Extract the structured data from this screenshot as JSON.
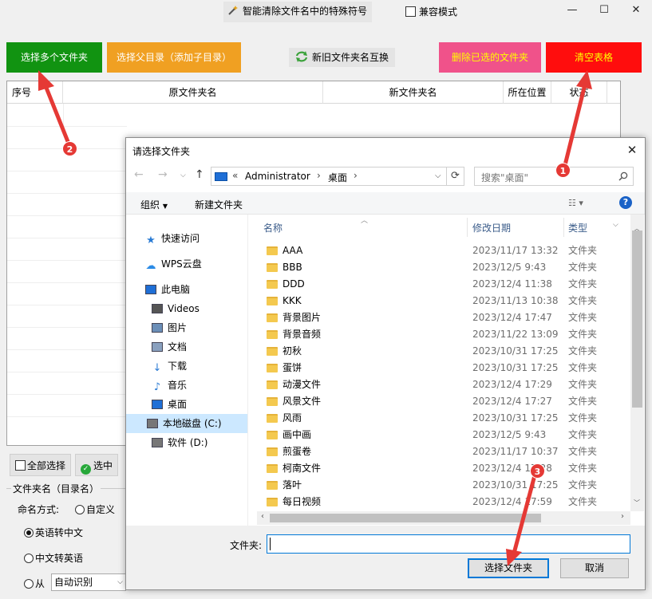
{
  "window": {
    "title": "智能清除文件名中的特殊符号",
    "compat_mode": "兼容模式",
    "min": "—",
    "max": "☐",
    "close": "✕"
  },
  "toolbar": {
    "select_multi": "选择多个文件夹",
    "select_parent": "选择父目录（添加子目录）",
    "swap_names": "新旧文件夹名互换",
    "delete_selected": "删除已选的文件夹",
    "clear_table": "清空表格"
  },
  "table": {
    "columns": [
      "序号",
      "原文件夹名",
      "新文件夹名",
      "所在位置",
      "状态"
    ]
  },
  "bottom": {
    "select_all": "全部选择",
    "select": "选中",
    "section": "文件夹名（目录名）",
    "naming_mode": "命名方式:",
    "custom": "自定义",
    "en_to_cn": "英语转中文",
    "cn_to_en": "中文转英语",
    "from": "从",
    "auto_detect": "自动识别"
  },
  "dialog": {
    "title": "请选择文件夹",
    "path_root": "Administrator",
    "path_current": "桌面",
    "search_placeholder": "搜索\"桌面\"",
    "organize": "组织",
    "new_folder": "新建文件夹",
    "nav": [
      {
        "label": "快速访问",
        "icon": "star-icon"
      },
      {
        "label": "WPS云盘",
        "icon": "cloud-icon"
      },
      {
        "label": "此电脑",
        "icon": "computer-icon"
      },
      {
        "label": "Videos",
        "icon": "video-icon"
      },
      {
        "label": "图片",
        "icon": "picture-icon"
      },
      {
        "label": "文档",
        "icon": "document-icon"
      },
      {
        "label": "下载",
        "icon": "download-icon"
      },
      {
        "label": "音乐",
        "icon": "music-icon"
      },
      {
        "label": "桌面",
        "icon": "desktop-icon"
      },
      {
        "label": "本地磁盘 (C:)",
        "icon": "drive-icon"
      },
      {
        "label": "软件 (D:)",
        "icon": "drive-icon"
      }
    ],
    "columns": {
      "name": "名称",
      "date": "修改日期",
      "type": "类型"
    },
    "files": [
      {
        "name": "AAA",
        "date": "2023/11/17 13:32",
        "type": "文件夹"
      },
      {
        "name": "BBB",
        "date": "2023/12/5 9:43",
        "type": "文件夹"
      },
      {
        "name": "DDD",
        "date": "2023/12/4 11:38",
        "type": "文件夹"
      },
      {
        "name": "KKK",
        "date": "2023/11/13 10:38",
        "type": "文件夹"
      },
      {
        "name": "背景图片",
        "date": "2023/12/4 17:47",
        "type": "文件夹"
      },
      {
        "name": "背景音频",
        "date": "2023/11/22 13:09",
        "type": "文件夹"
      },
      {
        "name": "初秋",
        "date": "2023/10/31 17:25",
        "type": "文件夹"
      },
      {
        "name": "蛋饼",
        "date": "2023/10/31 17:25",
        "type": "文件夹"
      },
      {
        "name": "动漫文件",
        "date": "2023/12/4 17:29",
        "type": "文件夹"
      },
      {
        "name": "风景文件",
        "date": "2023/12/4 17:27",
        "type": "文件夹"
      },
      {
        "name": "风雨",
        "date": "2023/10/31 17:25",
        "type": "文件夹"
      },
      {
        "name": "画中画",
        "date": "2023/12/5 9:43",
        "type": "文件夹"
      },
      {
        "name": "煎蛋卷",
        "date": "2023/11/17 10:37",
        "type": "文件夹"
      },
      {
        "name": "柯南文件",
        "date": "2023/12/4 17:28",
        "type": "文件夹"
      },
      {
        "name": "落叶",
        "date": "2023/10/31 17:25",
        "type": "文件夹"
      },
      {
        "name": "每日视频",
        "date": "2023/12/4 17:59",
        "type": "文件夹"
      }
    ],
    "folder_label": "文件夹:",
    "folder_value": "",
    "select_button": "选择文件夹",
    "cancel_button": "取消"
  },
  "annotations": [
    "1",
    "2",
    "3"
  ],
  "colors": {
    "green": "#119311",
    "orange": "#f0a022",
    "pink": "#f0528a",
    "red": "#ff0d0d",
    "yellow_text": "#ffff00",
    "arrow_red": "#e53935"
  }
}
